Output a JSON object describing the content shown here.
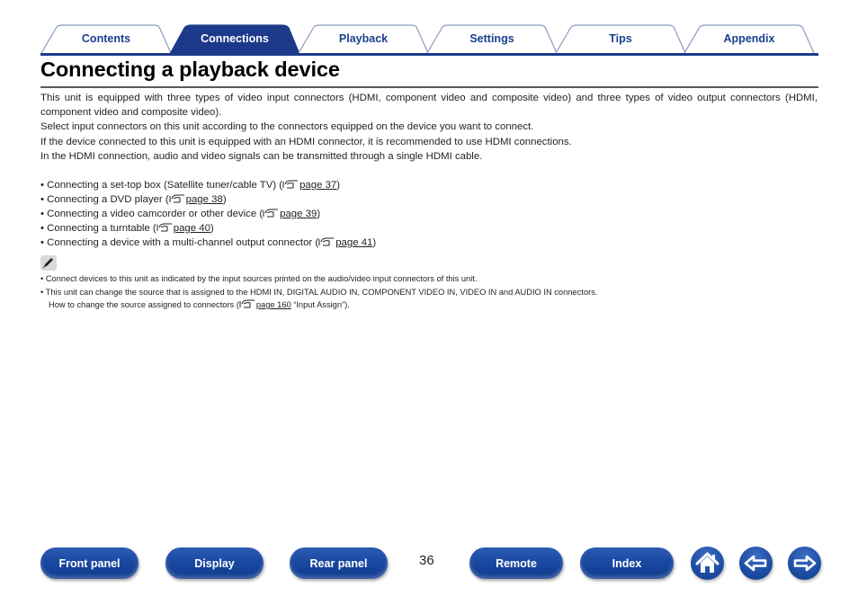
{
  "tabs": [
    {
      "label": "Contents",
      "active": false
    },
    {
      "label": "Connections",
      "active": true
    },
    {
      "label": "Playback",
      "active": false
    },
    {
      "label": "Settings",
      "active": false
    },
    {
      "label": "Tips",
      "active": false
    },
    {
      "label": "Appendix",
      "active": false
    }
  ],
  "page": {
    "title": "Connecting a playback device",
    "intro": [
      "This unit is equipped with three types of video input connectors (HDMI, component video and composite video) and three types of video output connectors (HDMI, component video and composite video).",
      "Select input connectors on this unit according to the connectors equipped on the device you want to connect.",
      "If the device connected to this unit is equipped with an HDMI connector, it is recommended to use HDMI connections.",
      "In the HDMI connection, audio and video signals can be transmitted through a single HDMI cable."
    ],
    "links": [
      {
        "text": "• Connecting a set-top box (Satellite tuner/cable TV) (",
        "page": "page 37",
        "suffix": ")"
      },
      {
        "text": "• Connecting a DVD player (",
        "page": "page 38",
        "suffix": ")"
      },
      {
        "text": "• Connecting a video camcorder or other device (",
        "page": "page 39",
        "suffix": ")"
      },
      {
        "text": "• Connecting a turntable (",
        "page": "page 40",
        "suffix": ")"
      },
      {
        "text": "• Connecting a device with a multi-channel output connector (",
        "page": "page 41",
        "suffix": ")"
      }
    ],
    "notes": {
      "icon": "pencil-icon",
      "items": [
        "• Connect devices to this unit as indicated by the input sources printed on the audio/video input connectors of this unit.",
        "• This unit can change the source that is assigned to the HDMI IN, DIGITAL AUDIO IN, COMPONENT VIDEO IN, VIDEO IN and AUDIO IN connectors."
      ],
      "continuation_prefix": "How to change the source assigned to connectors (",
      "continuation_link": "page 160",
      "continuation_suffix": " “Input Assign”)."
    }
  },
  "footer": {
    "page_number": "36",
    "buttons": {
      "front_panel": "Front panel",
      "display": "Display",
      "rear_panel": "Rear panel",
      "remote": "Remote",
      "index": "Index"
    },
    "icons": [
      "home-icon",
      "back-arrow-icon",
      "forward-arrow-icon"
    ]
  },
  "colors": {
    "brand_blue": "#1d3a8a",
    "tab_text": "#1b3f8f",
    "body_text": "#231f20"
  }
}
